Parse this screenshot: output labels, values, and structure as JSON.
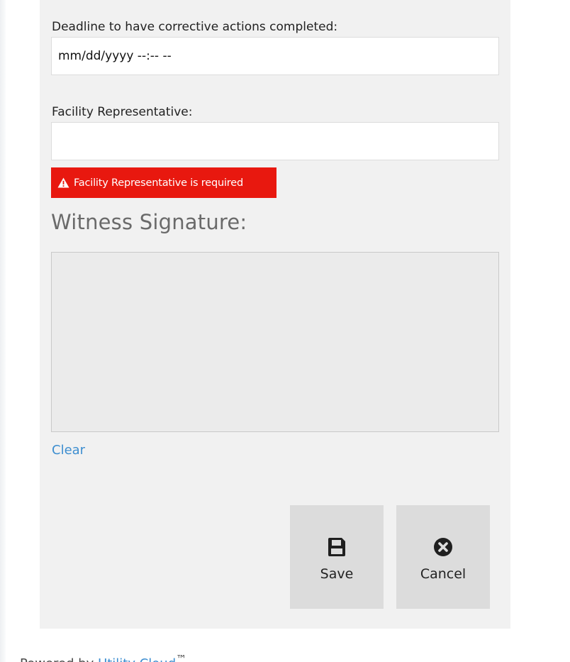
{
  "form": {
    "deadline": {
      "label": "Deadline to have corrective actions completed:",
      "value": "mm/dd/yyyy --:-- --"
    },
    "facility_representative": {
      "label": "Facility Representative:",
      "value": "",
      "error": "Facility Representative is required"
    },
    "witness_signature": {
      "heading": "Witness Signature:",
      "clear_label": "Clear"
    }
  },
  "actions": {
    "save": {
      "label": "Save",
      "icon": "save-icon"
    },
    "cancel": {
      "label": "Cancel",
      "icon": "cancel-circle-icon"
    }
  },
  "footer": {
    "prefix": "Powered by",
    "link_text": "Utility Cloud",
    "trademark": "™"
  },
  "colors": {
    "panel_bg": "#f1f1f1",
    "error_bg": "#e8180f",
    "link": "#3d8ed0",
    "button_bg": "#dcdcdc",
    "signature_pad_bg": "#ebebeb"
  }
}
